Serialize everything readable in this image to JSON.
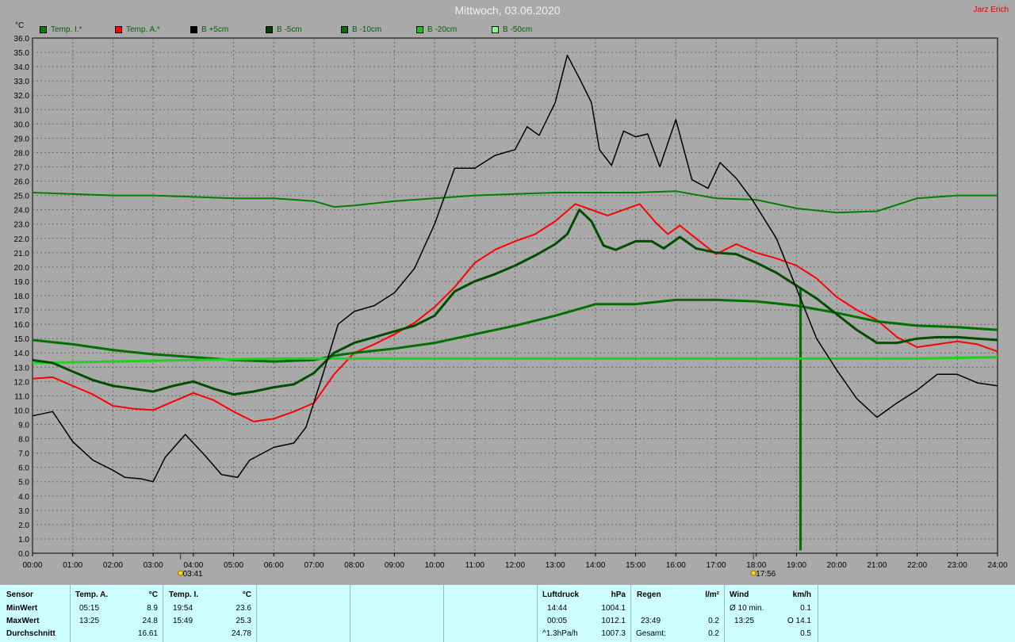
{
  "header": {
    "title": "Mittwoch, 03.06.2020",
    "author": "Jarz Erich",
    "unit": "°C"
  },
  "legend": [
    {
      "label": "Temp. I.*",
      "color": "#006400"
    },
    {
      "label": "Temp. A.*",
      "color": "#ff0000"
    },
    {
      "label": "B +5cm",
      "color": "#000000"
    },
    {
      "label": "B -5cm",
      "color": "#004000"
    },
    {
      "label": "B -10cm",
      "color": "#007000"
    },
    {
      "label": "B -20cm",
      "color": "#20c020"
    },
    {
      "label": "B -50cm",
      "color": "#80ff80"
    }
  ],
  "chart_data": {
    "type": "line",
    "title": "Mittwoch, 03.06.2020",
    "ylabel": "°C",
    "ylim": [
      0,
      36
    ],
    "xlim": [
      0,
      24
    ],
    "y_ticks": [
      "0.0",
      "1.0",
      "2.0",
      "3.0",
      "4.0",
      "5.0",
      "6.0",
      "7.0",
      "8.0",
      "9.0",
      "10.0",
      "11.0",
      "12.0",
      "13.0",
      "14.0",
      "15.0",
      "16.0",
      "17.0",
      "18.0",
      "19.0",
      "20.0",
      "21.0",
      "22.0",
      "23.0",
      "24.0",
      "25.0",
      "26.0",
      "27.0",
      "28.0",
      "29.0",
      "30.0",
      "31.0",
      "32.0",
      "33.0",
      "34.0",
      "35.0",
      "36.0"
    ],
    "x_ticks": [
      "00:00",
      "01:00",
      "02:00",
      "03:00",
      "04:00",
      "05:00",
      "06:00",
      "07:00",
      "08:00",
      "09:00",
      "10:00",
      "11:00",
      "12:00",
      "13:00",
      "14:00",
      "15:00",
      "16:00",
      "17:00",
      "18:00",
      "19:00",
      "20:00",
      "21:00",
      "22:00",
      "23:00",
      "24:00"
    ],
    "grid": true,
    "legend_position": "top",
    "markers": [
      {
        "label": "03:41",
        "x": 3.68
      },
      {
        "label": "17:56",
        "x": 17.93
      }
    ],
    "series": [
      {
        "name": "Temp. I.*",
        "color": "#008000",
        "width": 2,
        "points": [
          [
            0,
            25.2
          ],
          [
            1,
            25.1
          ],
          [
            2,
            25.0
          ],
          [
            3,
            25.0
          ],
          [
            4,
            24.9
          ],
          [
            5,
            24.8
          ],
          [
            6,
            24.8
          ],
          [
            7,
            24.6
          ],
          [
            7.5,
            24.2
          ],
          [
            8,
            24.3
          ],
          [
            9,
            24.6
          ],
          [
            10,
            24.8
          ],
          [
            11,
            25.0
          ],
          [
            12,
            25.1
          ],
          [
            13,
            25.2
          ],
          [
            14,
            25.2
          ],
          [
            15,
            25.2
          ],
          [
            16,
            25.3
          ],
          [
            17,
            24.8
          ],
          [
            18,
            24.7
          ],
          [
            19,
            24.1
          ],
          [
            20,
            23.8
          ],
          [
            21,
            23.9
          ],
          [
            22,
            24.8
          ],
          [
            23,
            25.0
          ],
          [
            24,
            25.0
          ]
        ]
      },
      {
        "name": "Temp. A.*",
        "color": "#ff0000",
        "width": 2,
        "points": [
          [
            0,
            12.2
          ],
          [
            0.5,
            12.3
          ],
          [
            1,
            11.7
          ],
          [
            1.5,
            11.1
          ],
          [
            2,
            10.3
          ],
          [
            2.5,
            10.1
          ],
          [
            3,
            10.0
          ],
          [
            3.5,
            10.6
          ],
          [
            4,
            11.2
          ],
          [
            4.5,
            10.7
          ],
          [
            5,
            9.9
          ],
          [
            5.5,
            9.2
          ],
          [
            6,
            9.4
          ],
          [
            6.5,
            9.9
          ],
          [
            7,
            10.5
          ],
          [
            7.5,
            12.5
          ],
          [
            8,
            14.0
          ],
          [
            8.5,
            14.6
          ],
          [
            9,
            15.3
          ],
          [
            9.5,
            16.1
          ],
          [
            10,
            17.2
          ],
          [
            10.5,
            18.6
          ],
          [
            11,
            20.3
          ],
          [
            11.5,
            21.2
          ],
          [
            12,
            21.8
          ],
          [
            12.5,
            22.3
          ],
          [
            13,
            23.2
          ],
          [
            13.5,
            24.4
          ],
          [
            14,
            23.9
          ],
          [
            14.3,
            23.6
          ],
          [
            14.7,
            24.0
          ],
          [
            15.1,
            24.4
          ],
          [
            15.5,
            23.1
          ],
          [
            15.8,
            22.3
          ],
          [
            16.1,
            22.9
          ],
          [
            16.5,
            22.0
          ],
          [
            17,
            20.9
          ],
          [
            17.5,
            21.6
          ],
          [
            18,
            21.0
          ],
          [
            18.5,
            20.6
          ],
          [
            19,
            20.1
          ],
          [
            19.5,
            19.2
          ],
          [
            20,
            17.9
          ],
          [
            20.5,
            17.0
          ],
          [
            21,
            16.3
          ],
          [
            21.5,
            15.1
          ],
          [
            22,
            14.4
          ],
          [
            22.5,
            14.6
          ],
          [
            23,
            14.8
          ],
          [
            23.5,
            14.6
          ],
          [
            24,
            14.1
          ]
        ]
      },
      {
        "name": "B +5cm",
        "color": "#000000",
        "width": 1.5,
        "points": [
          [
            0,
            9.6
          ],
          [
            0.5,
            9.9
          ],
          [
            1,
            7.8
          ],
          [
            1.5,
            6.5
          ],
          [
            2,
            5.8
          ],
          [
            2.3,
            5.3
          ],
          [
            2.7,
            5.2
          ],
          [
            3,
            5.0
          ],
          [
            3.3,
            6.7
          ],
          [
            3.8,
            8.3
          ],
          [
            4.3,
            6.8
          ],
          [
            4.7,
            5.5
          ],
          [
            5.1,
            5.3
          ],
          [
            5.4,
            6.5
          ],
          [
            6,
            7.4
          ],
          [
            6.5,
            7.7
          ],
          [
            6.8,
            8.8
          ],
          [
            7.2,
            12.3
          ],
          [
            7.6,
            16.0
          ],
          [
            8,
            16.9
          ],
          [
            8.5,
            17.3
          ],
          [
            9,
            18.2
          ],
          [
            9.5,
            19.9
          ],
          [
            10,
            23.0
          ],
          [
            10.5,
            26.9
          ],
          [
            11,
            26.9
          ],
          [
            11.5,
            27.8
          ],
          [
            12,
            28.2
          ],
          [
            12.3,
            29.8
          ],
          [
            12.6,
            29.2
          ],
          [
            13,
            31.5
          ],
          [
            13.3,
            34.8
          ],
          [
            13.6,
            33.2
          ],
          [
            13.9,
            31.5
          ],
          [
            14.1,
            28.2
          ],
          [
            14.4,
            27.1
          ],
          [
            14.7,
            29.5
          ],
          [
            15.0,
            29.1
          ],
          [
            15.3,
            29.3
          ],
          [
            15.6,
            27.0
          ],
          [
            16.0,
            30.3
          ],
          [
            16.4,
            26.1
          ],
          [
            16.8,
            25.5
          ],
          [
            17.1,
            27.3
          ],
          [
            17.5,
            26.2
          ],
          [
            17.9,
            24.7
          ],
          [
            18.5,
            22.0
          ],
          [
            19.0,
            18.5
          ],
          [
            19.5,
            15.0
          ],
          [
            20.0,
            12.8
          ],
          [
            20.5,
            10.8
          ],
          [
            21.0,
            9.5
          ],
          [
            21.5,
            10.5
          ],
          [
            22.0,
            11.4
          ],
          [
            22.5,
            12.5
          ],
          [
            23.0,
            12.5
          ],
          [
            23.5,
            11.9
          ],
          [
            24.0,
            11.7
          ]
        ]
      },
      {
        "name": "B -5cm",
        "color": "#004d00",
        "width": 3,
        "points": [
          [
            0,
            13.5
          ],
          [
            0.5,
            13.3
          ],
          [
            1,
            12.7
          ],
          [
            1.5,
            12.1
          ],
          [
            2,
            11.7
          ],
          [
            2.5,
            11.5
          ],
          [
            3,
            11.3
          ],
          [
            3.5,
            11.7
          ],
          [
            4,
            12.0
          ],
          [
            4.5,
            11.5
          ],
          [
            5,
            11.1
          ],
          [
            5.5,
            11.3
          ],
          [
            6,
            11.6
          ],
          [
            6.5,
            11.8
          ],
          [
            7,
            12.6
          ],
          [
            7.5,
            14.0
          ],
          [
            8,
            14.7
          ],
          [
            8.5,
            15.1
          ],
          [
            9,
            15.5
          ],
          [
            9.5,
            15.9
          ],
          [
            10,
            16.6
          ],
          [
            10.5,
            18.3
          ],
          [
            11,
            19.0
          ],
          [
            11.5,
            19.5
          ],
          [
            12,
            20.1
          ],
          [
            12.5,
            20.8
          ],
          [
            13,
            21.6
          ],
          [
            13.3,
            22.3
          ],
          [
            13.6,
            24.0
          ],
          [
            13.9,
            23.2
          ],
          [
            14.2,
            21.5
          ],
          [
            14.5,
            21.2
          ],
          [
            15,
            21.8
          ],
          [
            15.4,
            21.8
          ],
          [
            15.7,
            21.3
          ],
          [
            16.1,
            22.1
          ],
          [
            16.5,
            21.3
          ],
          [
            17,
            21.0
          ],
          [
            17.5,
            20.9
          ],
          [
            18,
            20.3
          ],
          [
            18.5,
            19.6
          ],
          [
            19,
            18.7
          ],
          [
            19.5,
            17.8
          ],
          [
            20,
            16.7
          ],
          [
            20.5,
            15.6
          ],
          [
            21,
            14.7
          ],
          [
            21.5,
            14.7
          ],
          [
            22,
            15.0
          ],
          [
            22.5,
            15.1
          ],
          [
            23,
            15.1
          ],
          [
            23.5,
            15.0
          ],
          [
            24,
            14.9
          ]
        ]
      },
      {
        "name": "B -10cm",
        "color": "#007000",
        "width": 3,
        "points": [
          [
            0,
            14.9
          ],
          [
            1,
            14.6
          ],
          [
            2,
            14.2
          ],
          [
            3,
            13.9
          ],
          [
            4,
            13.7
          ],
          [
            5,
            13.5
          ],
          [
            6,
            13.4
          ],
          [
            7,
            13.5
          ],
          [
            7.5,
            13.8
          ],
          [
            8,
            14.0
          ],
          [
            9,
            14.3
          ],
          [
            10,
            14.7
          ],
          [
            11,
            15.3
          ],
          [
            12,
            15.9
          ],
          [
            13,
            16.6
          ],
          [
            14,
            17.4
          ],
          [
            15,
            17.4
          ],
          [
            16,
            17.7
          ],
          [
            17,
            17.7
          ],
          [
            18,
            17.6
          ],
          [
            19,
            17.3
          ],
          [
            20,
            16.8
          ],
          [
            21,
            16.2
          ],
          [
            22,
            15.9
          ],
          [
            23,
            15.8
          ],
          [
            24,
            15.6
          ]
        ],
        "spike": {
          "x": 19.1,
          "from": 18.5,
          "to": 0.2
        }
      },
      {
        "name": "B -20cm",
        "color": "#22d022",
        "width": 3,
        "points": [
          [
            0,
            13.3
          ],
          [
            2,
            13.4
          ],
          [
            4,
            13.5
          ],
          [
            6,
            13.6
          ],
          [
            8,
            13.6
          ],
          [
            10,
            13.6
          ],
          [
            12,
            13.6
          ],
          [
            14,
            13.6
          ],
          [
            16,
            13.6
          ],
          [
            18,
            13.6
          ],
          [
            20,
            13.6
          ],
          [
            22,
            13.6
          ],
          [
            24,
            13.7
          ]
        ]
      },
      {
        "name": "B -50cm",
        "color": "#90ee90",
        "width": 1,
        "points": []
      }
    ]
  },
  "stats": {
    "sensor": "Sensor",
    "min": "MinWert",
    "max": "MaxWert",
    "avg": "Durchschnitt",
    "temp_a": {
      "title": "Temp. A.",
      "unit": "°C",
      "min_time": "05:15",
      "min_val": "8.9",
      "max_time": "13:25",
      "max_val": "24.8",
      "avg": "16.61"
    },
    "temp_i": {
      "title": "Temp. I.",
      "unit": "°C",
      "min_time": "19:54",
      "min_val": "23.6",
      "max_time": "15:49",
      "max_val": "25.3",
      "avg": "24.78"
    },
    "pressure": {
      "title": "Luftdruck",
      "unit": "hPa",
      "r1a": "14:44",
      "r1b": "1004.1",
      "r2a": "00:05",
      "r2b": "1012.1",
      "r3a": "^1.3hPa/h",
      "r3b": "1007.3"
    },
    "rain": {
      "title": "Regen",
      "unit": "l/m²",
      "r2a": "23:49",
      "r2b": "0.2",
      "r3a": "Gesamt:",
      "r3b": "0.2"
    },
    "wind": {
      "title": "Wind",
      "unit": "km/h",
      "r1a": "Ø 10 min.",
      "r1b": "0.1",
      "r2a": "13:25",
      "r2b": "O 14.1",
      "r3b": "0.5"
    }
  }
}
